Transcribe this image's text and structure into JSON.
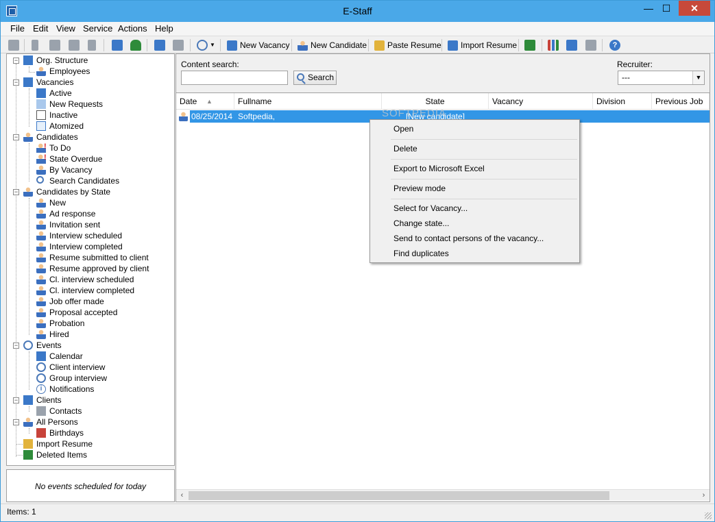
{
  "window": {
    "title": "E-Staff",
    "minimize": "—",
    "maximize": "☐",
    "close": "✕"
  },
  "menu": [
    "File",
    "Edit",
    "View",
    "Service",
    "Actions",
    "Help"
  ],
  "toolbar": {
    "new_vacancy": "New Vacancy",
    "new_candidate": "New Candidate",
    "paste_resume": "Paste Resume",
    "import_resume": "Import Resume"
  },
  "tree": {
    "org_structure": "Org. Structure",
    "employees": "Employees",
    "vacancies": "Vacancies",
    "active": "Active",
    "new_requests": "New Requests",
    "inactive": "Inactive",
    "atomized": "Atomized",
    "candidates": "Candidates",
    "to_do": "To Do",
    "state_overdue": "State Overdue",
    "by_vacancy": "By Vacancy",
    "search_candidates": "Search Candidates",
    "candidates_by_state": "Candidates by State",
    "states": [
      "New",
      "Ad response",
      "Invitation sent",
      "Interview scheduled",
      "Interview completed",
      "Resume submitted to client",
      "Resume approved by client",
      "Cl. interview scheduled",
      "Cl. interview completed",
      "Job offer made",
      "Proposal accepted",
      "Probation",
      "Hired"
    ],
    "events": "Events",
    "calendar": "Calendar",
    "client_interview": "Client interview",
    "group_interview": "Group interview",
    "notifications": "Notifications",
    "clients": "Clients",
    "contacts": "Contacts",
    "all_persons": "All Persons",
    "birthdays": "Birthdays",
    "import_resume": "Import Resume",
    "deleted_items": "Deleted Items"
  },
  "events_panel": {
    "text": "No events scheduled for today"
  },
  "search": {
    "label": "Content search:",
    "value": "",
    "button": "Search"
  },
  "recruiter": {
    "label": "Recruiter:",
    "value": "---"
  },
  "grid": {
    "columns": [
      "Date",
      "Fullname",
      "State",
      "Vacancy",
      "Division",
      "Previous Job"
    ],
    "rows": [
      {
        "date": "08/25/2014",
        "fullname": "Softpedia,",
        "state": "[New candidate]",
        "vacancy": "",
        "division": "",
        "previous_job": ""
      }
    ]
  },
  "watermark": "SOFTPEDIA",
  "context_menu": [
    "Open",
    "Delete",
    "Export to Microsoft Excel",
    "Preview mode",
    "Select for Vacancy...",
    "Change state...",
    "Send to contact persons of the vacancy...",
    "Find duplicates"
  ],
  "status": {
    "items": "Items: 1"
  }
}
